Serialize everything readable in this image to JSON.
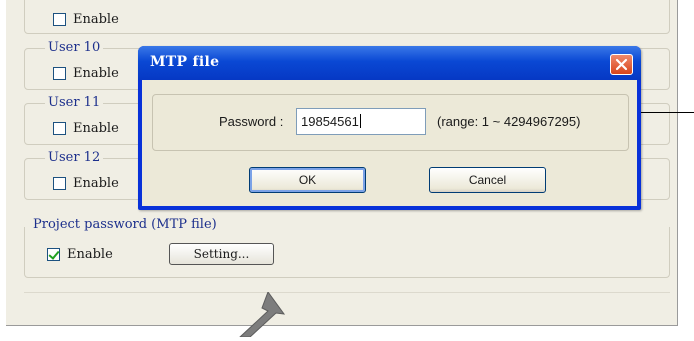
{
  "settings": {
    "top_enable_label": "Enable",
    "users": [
      {
        "title": "User 10",
        "enable_label": "Enable"
      },
      {
        "title": "User 11",
        "enable_label": "Enable"
      },
      {
        "title": "User 12",
        "enable_label": "Enable"
      }
    ],
    "project_password": {
      "title": "Project password (MTP file)",
      "enable_label": "Enable",
      "enabled": true,
      "setting_label": "Setting..."
    }
  },
  "dialog": {
    "title": "MTP file",
    "password_label": "Password :",
    "password_value": "19854561",
    "range_text": "(range: 1 ~ 4294967295)",
    "ok_label": "OK",
    "cancel_label": "Cancel"
  },
  "colors": {
    "group_title": "#1c2f8c",
    "titlebar": "#0a48d4",
    "close": "#d9451b",
    "panel_bg": "#f0eee4"
  },
  "icons": {
    "close": "close-icon",
    "pointer_arrow": "arrow-icon"
  }
}
